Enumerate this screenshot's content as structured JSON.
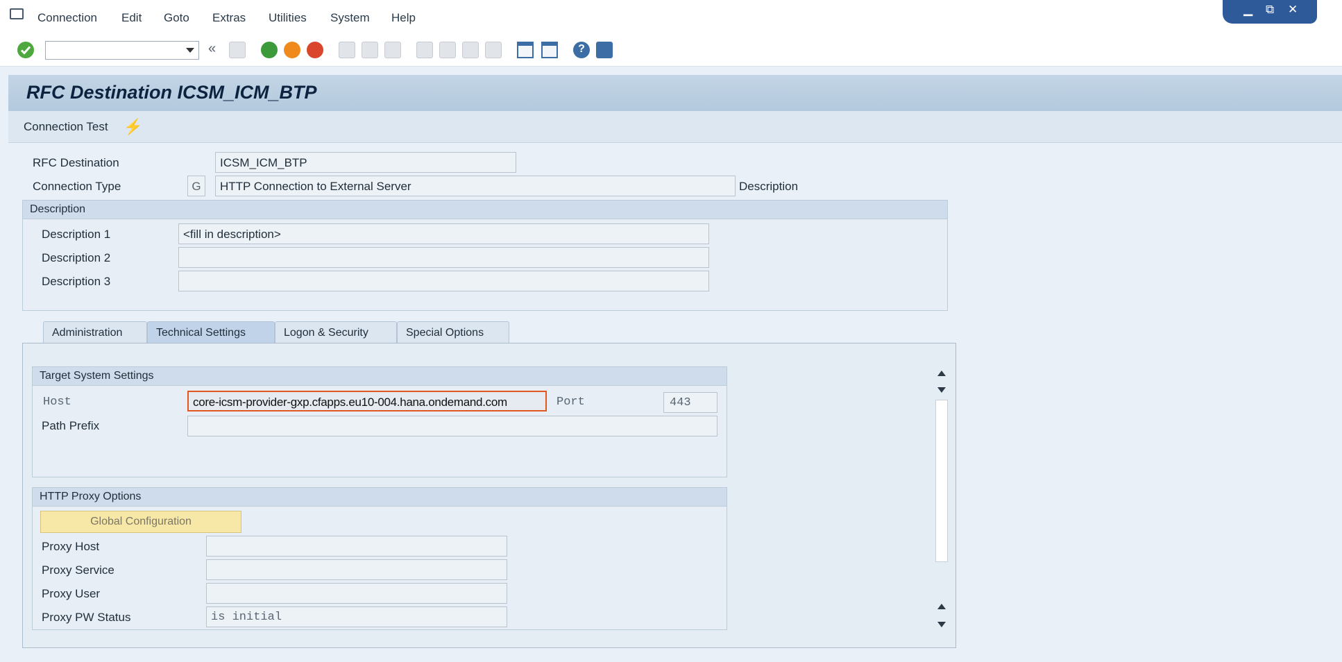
{
  "menu": {
    "items": [
      "Connection",
      "Edit",
      "Goto",
      "Extras",
      "Utilities",
      "System",
      "Help"
    ]
  },
  "window_controls": {
    "minimize": "▁",
    "restore": "⧉",
    "close": "✕"
  },
  "toolbar": {
    "command_value": "",
    "collapse_glyph": "«"
  },
  "page": {
    "title": "RFC Destination ICSM_ICM_BTP",
    "app_button": "Connection Test"
  },
  "header_fields": {
    "rfc_destination_label": "RFC Destination",
    "rfc_destination_value": "ICSM_ICM_BTP",
    "connection_type_label": "Connection Type",
    "connection_type_code": "G",
    "connection_type_value": "HTTP Connection to External Server",
    "description_link": "Description"
  },
  "description_group": {
    "title": "Description",
    "rows": [
      {
        "label": "Description 1",
        "value": "<fill in description>"
      },
      {
        "label": "Description 2",
        "value": ""
      },
      {
        "label": "Description 3",
        "value": ""
      }
    ]
  },
  "tabs": [
    {
      "label": "Administration",
      "active": false
    },
    {
      "label": "Technical Settings",
      "active": true
    },
    {
      "label": "Logon & Security",
      "active": false
    },
    {
      "label": "Special Options",
      "active": false
    }
  ],
  "target_system": {
    "title": "Target System Settings",
    "host_label": "Host",
    "host_value": "core-icsm-provider-gxp.cfapps.eu10-004.hana.ondemand.com",
    "port_label": "Port",
    "port_value": "443",
    "path_prefix_label": "Path Prefix",
    "path_prefix_value": ""
  },
  "proxy": {
    "title": "HTTP Proxy Options",
    "global_config_button": "Global Configuration",
    "rows": [
      {
        "label": "Proxy Host",
        "value": ""
      },
      {
        "label": "Proxy Service",
        "value": ""
      },
      {
        "label": "Proxy User",
        "value": ""
      },
      {
        "label": "Proxy PW Status",
        "value": "is initial"
      }
    ]
  },
  "colors": {
    "accent_blue": "#2f5a99",
    "title_bar": "#c3d5e6",
    "button_yellow": "#f7e8a7",
    "focus_orange": "#e2571e"
  }
}
